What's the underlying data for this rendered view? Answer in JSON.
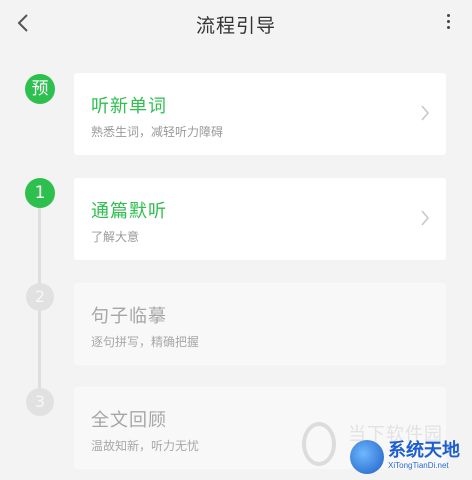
{
  "header": {
    "title": "流程引导",
    "back_icon": "chevron-left-icon",
    "more_icon": "more-vertical-icon"
  },
  "colors": {
    "accent": "#2ec04f",
    "background": "#f3f3f3",
    "disabled_badge": "#e1e1e1"
  },
  "steps": [
    {
      "marker": "预",
      "title": "听新单词",
      "subtitle": "熟悉生词，减轻听力障碍",
      "state": "active"
    },
    {
      "marker": "1",
      "title": "通篇默听",
      "subtitle": "了解大意",
      "state": "active"
    },
    {
      "marker": "2",
      "title": "句子临摹",
      "subtitle": "逐句拼写，精确把握",
      "state": "locked"
    },
    {
      "marker": "3",
      "title": "全文回顾",
      "subtitle": "温故知新，听力无忧",
      "state": "locked"
    }
  ],
  "watermark": {
    "gray_text": "当下软件园",
    "brand": "系统天地",
    "url": "XiTongTianDi.net"
  }
}
